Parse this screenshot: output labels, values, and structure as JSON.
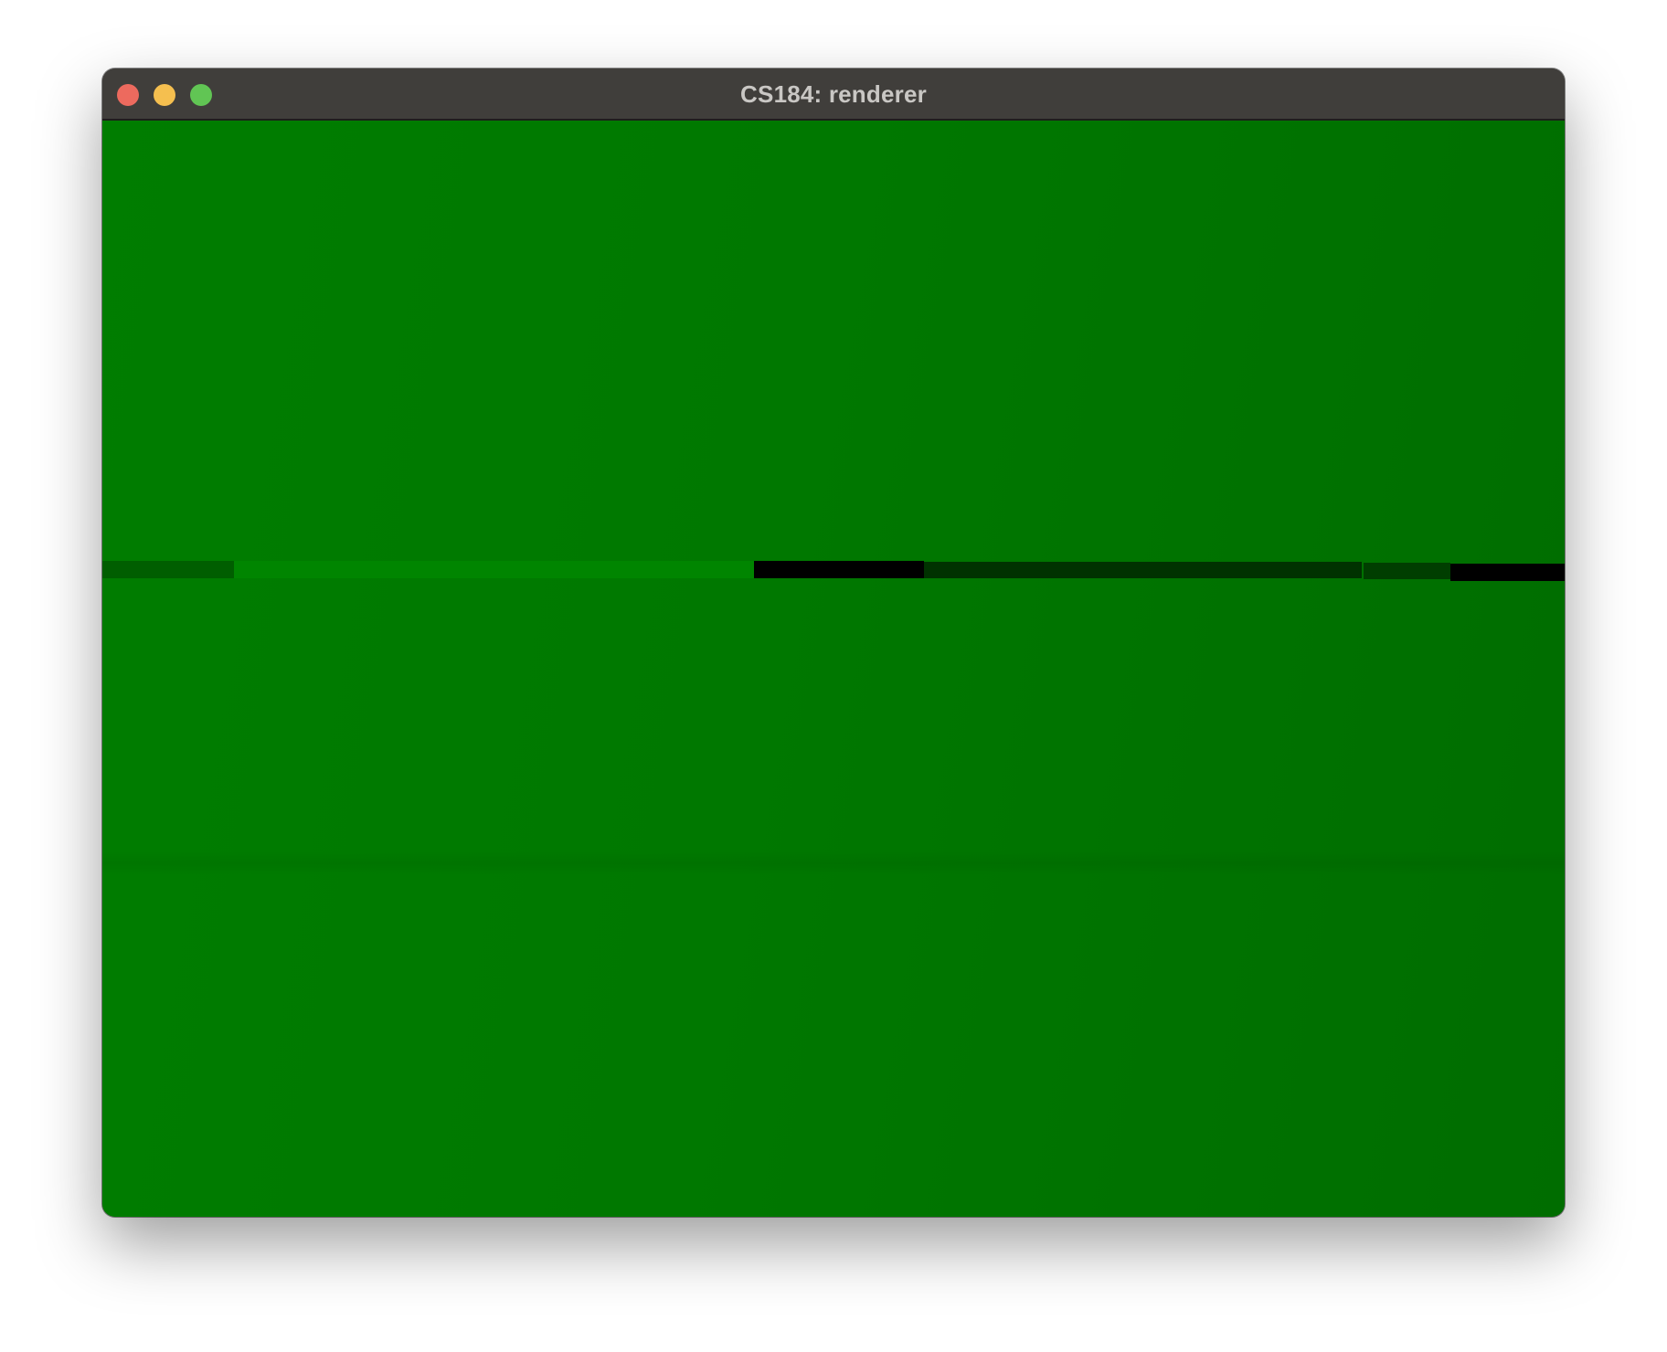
{
  "window": {
    "title": "CS184: renderer",
    "buttons": {
      "close_color": "#ed6a5e",
      "minimize_color": "#f5bf4f",
      "maximize_color": "#61c554"
    }
  },
  "viewport": {
    "background_colors": [
      "#007d00",
      "#007800",
      "#006d00"
    ],
    "stripe_colors": {
      "dark_green": "#005e00",
      "bright_green": "#008500",
      "black": "#000000",
      "deep_green": "#003200",
      "mid_dark_green": "#003e00"
    }
  }
}
